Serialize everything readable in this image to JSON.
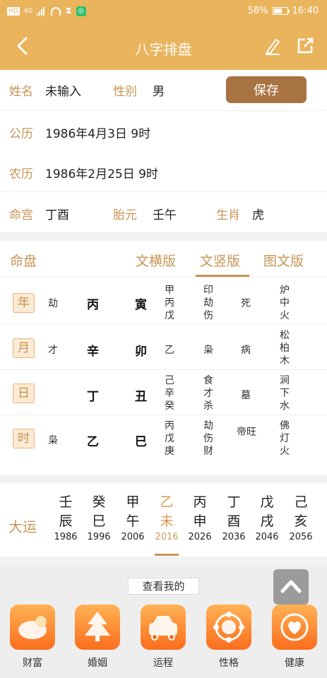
{
  "status": {
    "sim_tag": "HD",
    "sim_sup": "4G",
    "battery": "58%",
    "time": "16:40"
  },
  "nav": {
    "title": "八字排盘"
  },
  "form": {
    "name_label": "姓名",
    "name_value": "未输入",
    "gender_label": "性别",
    "gender_value": "男",
    "save_label": "保存",
    "solar_label": "公历",
    "solar_value": "1986年4月3日 9时",
    "lunar_label": "农历",
    "lunar_value": "1986年2月25日 9时",
    "minggong_label": "命宫",
    "minggong_value": "丁酉",
    "taiyuan_label": "胎元",
    "taiyuan_value": "壬午",
    "zodiac_label": "生肖",
    "zodiac_value": "虎"
  },
  "panel": {
    "title": "命盘",
    "tabs": [
      "文横版",
      "文竖版",
      "图文版"
    ],
    "active_tab": "文竖版",
    "rows": [
      {
        "pillar": "年",
        "shishen": "劫",
        "gan": "丙",
        "zhi": "寅",
        "canggan": [
          "甲",
          "丙",
          "戊"
        ],
        "cangshen": [
          "印",
          "劫",
          "伤"
        ],
        "state": "死",
        "nayin": [
          "炉",
          "中",
          "火"
        ]
      },
      {
        "pillar": "月",
        "shishen": "才",
        "gan": "辛",
        "zhi": "卯",
        "canggan": [
          "乙"
        ],
        "cangshen": [
          "枭"
        ],
        "state": "病",
        "nayin": [
          "松",
          "柏",
          "木"
        ]
      },
      {
        "pillar": "日",
        "shishen": "",
        "gan": "丁",
        "zhi": "丑",
        "canggan": [
          "己",
          "辛",
          "癸"
        ],
        "cangshen": [
          "食",
          "才",
          "杀"
        ],
        "state": "墓",
        "nayin": [
          "涧",
          "下",
          "水"
        ]
      },
      {
        "pillar": "时",
        "shishen": "枭",
        "gan": "乙",
        "zhi": "巳",
        "canggan": [
          "丙",
          "戊",
          "庚"
        ],
        "cangshen": [
          "劫",
          "伤",
          "财"
        ],
        "state": "帝旺",
        "nayin": [
          "佛",
          "灯",
          "火"
        ]
      }
    ]
  },
  "dayun": {
    "label": "大运",
    "items": [
      {
        "gan": "壬",
        "zhi": "辰",
        "year": "1986"
      },
      {
        "gan": "癸",
        "zhi": "巳",
        "year": "1996"
      },
      {
        "gan": "甲",
        "zhi": "午",
        "year": "2006"
      },
      {
        "gan": "乙",
        "zhi": "未",
        "year": "2016"
      },
      {
        "gan": "丙",
        "zhi": "申",
        "year": "2026"
      },
      {
        "gan": "丁",
        "zhi": "酉",
        "year": "2036"
      },
      {
        "gan": "戊",
        "zhi": "戌",
        "year": "2046"
      },
      {
        "gan": "己",
        "zhi": "亥",
        "year": "2056"
      }
    ],
    "active_year": "2016"
  },
  "bottom": {
    "title": "查看我的",
    "functions": [
      {
        "label": "财富",
        "icon": "wealth-icon"
      },
      {
        "label": "婚姻",
        "icon": "marriage-icon"
      },
      {
        "label": "运程",
        "icon": "fortune-icon"
      },
      {
        "label": "性格",
        "icon": "personality-icon"
      },
      {
        "label": "健康",
        "icon": "health-icon"
      }
    ]
  },
  "colors": {
    "header": "#e9b45c",
    "accent": "#c79454",
    "save": "#a87342",
    "func_gradient_top": "#ffb255",
    "func_gradient_bottom": "#fb6d1d"
  }
}
